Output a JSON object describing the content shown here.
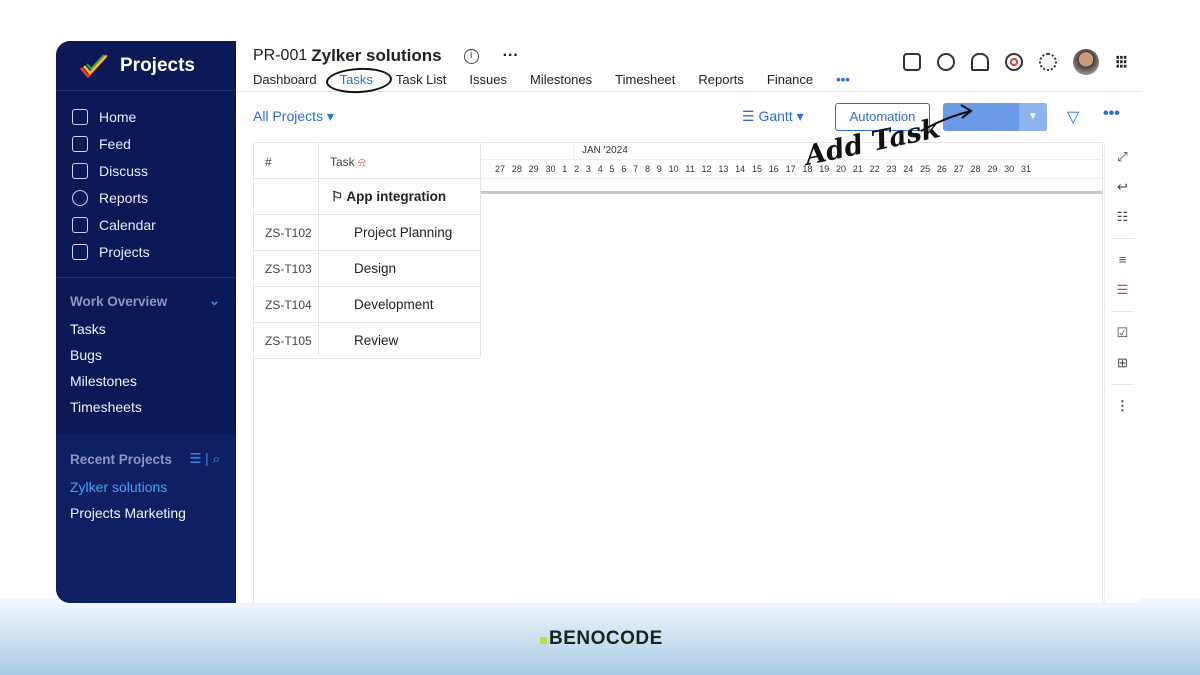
{
  "sidebar": {
    "app_name": "Projects",
    "nav": [
      "Home",
      "Feed",
      "Discuss",
      "Reports",
      "Calendar",
      "Projects"
    ],
    "work_overview": {
      "title": "Work Overview",
      "items": [
        "Tasks",
        "Bugs",
        "Milestones",
        "Timesheets"
      ]
    },
    "recent_projects": {
      "title": "Recent Projects",
      "items": [
        "Zylker solutions",
        "Projects Marketing"
      ]
    }
  },
  "header": {
    "project_id": "PR-001",
    "project_name": "Zylker solutions",
    "tabs": [
      "Dashboard",
      "Tasks",
      "Task List",
      "Issues",
      "Milestones",
      "Timesheet",
      "Reports",
      "Finance"
    ],
    "active_tab": "Tasks",
    "more": "•••"
  },
  "toolbar": {
    "project_filter": "All Projects",
    "view": "Gantt",
    "automation": "Automation",
    "more": "•••"
  },
  "annotation": "Add Task",
  "grid": {
    "col_id": "#",
    "col_task": "Task",
    "group": "App integration",
    "rows": [
      {
        "id": "ZS-T102",
        "task": "Project Planning"
      },
      {
        "id": "ZS-T103",
        "task": "Design"
      },
      {
        "id": "ZS-T104",
        "task": "Development"
      },
      {
        "id": "ZS-T105",
        "task": "Review"
      }
    ],
    "month": "JAN '2024",
    "days": [
      "27",
      "28",
      "29",
      "30",
      "1",
      "2",
      "3",
      "4",
      "5",
      "6",
      "7",
      "8",
      "9",
      "10",
      "11",
      "12",
      "13",
      "14",
      "15",
      "16",
      "17",
      "18",
      "19",
      "20",
      "21",
      "22",
      "23",
      "24",
      "25",
      "26",
      "27",
      "28",
      "29",
      "30",
      "31"
    ]
  },
  "brand": "BENOCODE",
  "colors": {
    "sidebar": "#0b1957",
    "accent": "#2a6fdb",
    "add_task": "#6a9ae8"
  }
}
